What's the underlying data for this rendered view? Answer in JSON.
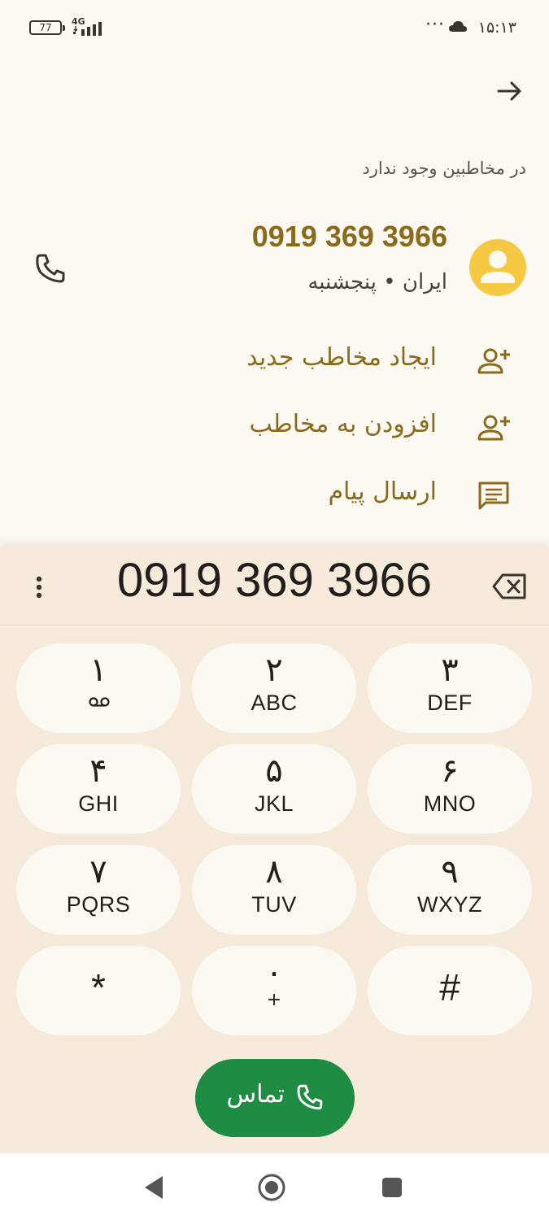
{
  "status_bar": {
    "battery": "77",
    "network": "4G",
    "time": "۱۵:۱۳",
    "more": "···"
  },
  "header": {
    "not_in_contacts": "در مخاطبین وجود ندارد"
  },
  "contact": {
    "number": "0919 369 3966",
    "subtitle": "ایران • پنجشنبه"
  },
  "actions": [
    {
      "label": "ایجاد مخاطب جدید",
      "icon": "person-add-icon"
    },
    {
      "label": "افزودن به مخاطب",
      "icon": "person-add-icon"
    },
    {
      "label": "ارسال پیام",
      "icon": "message-icon"
    }
  ],
  "dialer": {
    "dialed_number": "0919 369 3966",
    "keys": [
      {
        "digit": "۱",
        "letters": ""
      },
      {
        "digit": "۲",
        "letters": "ABC"
      },
      {
        "digit": "۳",
        "letters": "DEF"
      },
      {
        "digit": "۴",
        "letters": "GHI"
      },
      {
        "digit": "۵",
        "letters": "JKL"
      },
      {
        "digit": "۶",
        "letters": "MNO"
      },
      {
        "digit": "۷",
        "letters": "PQRS"
      },
      {
        "digit": "۸",
        "letters": "TUV"
      },
      {
        "digit": "۹",
        "letters": "WXYZ"
      },
      {
        "digit": "*",
        "letters": ""
      },
      {
        "digit": "۰",
        "letters": "+"
      },
      {
        "digit": "#",
        "letters": ""
      }
    ],
    "call_label": "تماس"
  },
  "colors": {
    "accent": "#8a6b1c",
    "avatar": "#f6c944",
    "call_button": "#1e8c43",
    "sheet": "#f6ebdb",
    "background": "#fcf8f2"
  }
}
